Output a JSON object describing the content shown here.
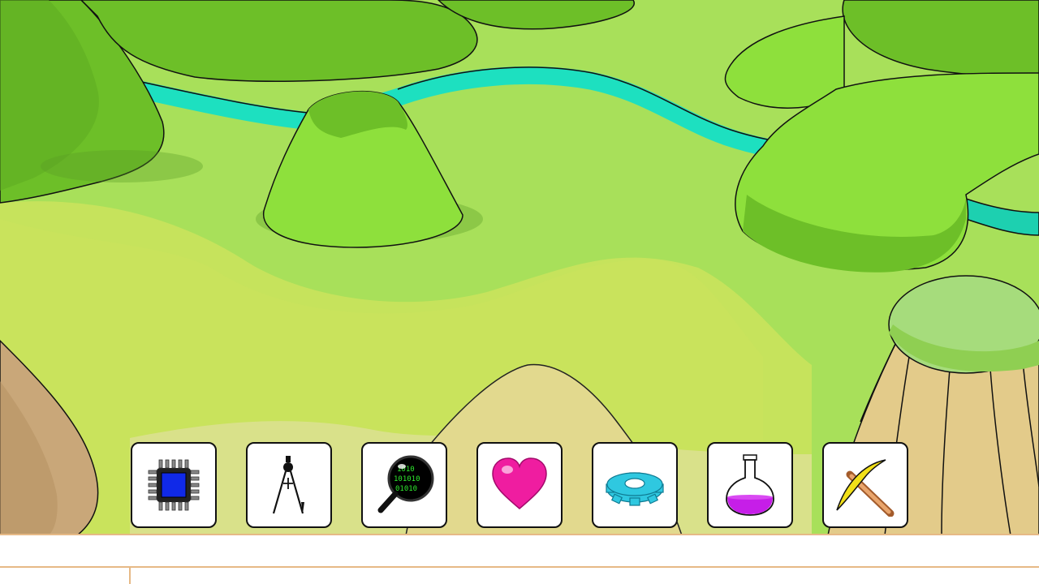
{
  "scene": {
    "description_icons": [
      "hills",
      "river",
      "tree-stump"
    ]
  },
  "toolbar": {
    "tools": [
      {
        "icon": "microchip-icon"
      },
      {
        "icon": "compass-drawing-icon"
      },
      {
        "icon": "binary-magnifier-icon"
      },
      {
        "icon": "heart-icon"
      },
      {
        "icon": "gear-icon"
      },
      {
        "icon": "potion-flask-icon"
      },
      {
        "icon": "pickaxe-icon"
      }
    ]
  },
  "colors": {
    "grass_light": "#a8e05a",
    "grass_mid": "#8ee03c",
    "grass_dark": "#6dbf28",
    "river": "#1de0c0",
    "sand": "#e2d98e",
    "dirt": "#c9a779",
    "stump": "#e3cb8a",
    "stump_top": "#a6dc7c",
    "bottom_border": "#e6b986"
  }
}
